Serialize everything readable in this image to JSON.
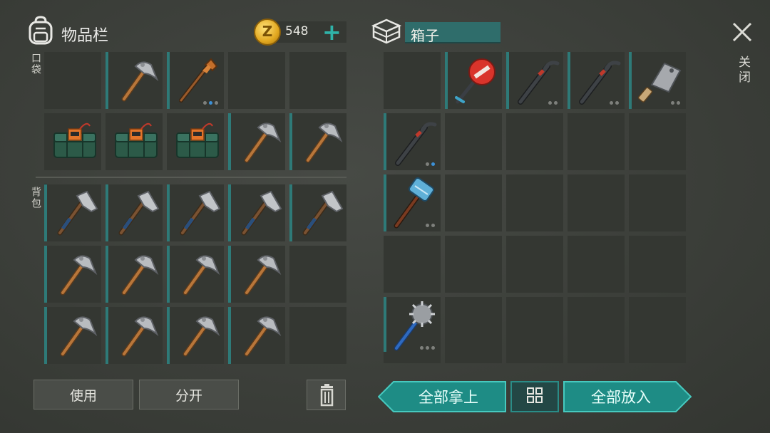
{
  "inventory": {
    "title": "物品栏",
    "pocket_label": "口袋",
    "backpack_label": "背包",
    "coins": {
      "symbol": "Z",
      "amount": "548",
      "add": "+"
    }
  },
  "container": {
    "name": "箱子"
  },
  "close": {
    "label": "关闭"
  },
  "buttons": {
    "use": "使用",
    "split": "分开",
    "take_all": "全部拿上",
    "put_all": "全部放入"
  },
  "colors": {
    "accent": "#2fb3a9",
    "slot": "#343732",
    "strip": "#2e7a78"
  },
  "pocket_slots": [
    {
      "item": "",
      "strip": false,
      "dots": []
    },
    {
      "item": "pickaxe-icon",
      "strip": true,
      "dots": []
    },
    {
      "item": "hoe-icon",
      "strip": true,
      "dots": [
        "g",
        "b",
        "g"
      ]
    },
    {
      "item": "",
      "strip": false,
      "dots": []
    },
    {
      "item": "",
      "strip": false,
      "dots": []
    },
    {
      "item": "explosive-pack-icon",
      "strip": false,
      "dots": []
    },
    {
      "item": "explosive-pack-icon",
      "strip": false,
      "dots": []
    },
    {
      "item": "explosive-pack-icon",
      "strip": false,
      "dots": []
    },
    {
      "item": "pickaxe-icon",
      "strip": true,
      "dots": []
    },
    {
      "item": "pickaxe-icon",
      "strip": true,
      "dots": []
    }
  ],
  "backpack_slots": [
    {
      "item": "hatchet-icon",
      "strip": true,
      "dots": []
    },
    {
      "item": "hatchet-icon",
      "strip": true,
      "dots": []
    },
    {
      "item": "hatchet-icon",
      "strip": true,
      "dots": []
    },
    {
      "item": "hatchet-icon",
      "strip": true,
      "dots": []
    },
    {
      "item": "hatchet-icon",
      "strip": true,
      "dots": []
    },
    {
      "item": "pickaxe-icon",
      "strip": true,
      "dots": []
    },
    {
      "item": "pickaxe-icon",
      "strip": true,
      "dots": []
    },
    {
      "item": "pickaxe-icon",
      "strip": true,
      "dots": []
    },
    {
      "item": "pickaxe-icon",
      "strip": true,
      "dots": []
    },
    {
      "item": "",
      "strip": false,
      "dots": []
    },
    {
      "item": "pickaxe-icon",
      "strip": true,
      "dots": []
    },
    {
      "item": "pickaxe-icon",
      "strip": true,
      "dots": []
    },
    {
      "item": "pickaxe-icon",
      "strip": true,
      "dots": []
    },
    {
      "item": "pickaxe-icon",
      "strip": true,
      "dots": []
    },
    {
      "item": "",
      "strip": false,
      "dots": []
    }
  ],
  "chest_slots": [
    {
      "item": "",
      "strip": false,
      "dots": []
    },
    {
      "item": "stop-sign-icon",
      "strip": true,
      "dots": []
    },
    {
      "item": "crowbar-icon",
      "strip": true,
      "dots": [
        "g",
        "g"
      ]
    },
    {
      "item": "crowbar-icon",
      "strip": true,
      "dots": [
        "g",
        "g"
      ]
    },
    {
      "item": "cleaver-icon",
      "strip": true,
      "dots": [
        "g",
        "g"
      ]
    },
    {
      "item": "crowbar-icon",
      "strip": true,
      "dots": [
        "g",
        "b"
      ]
    },
    {
      "item": "",
      "strip": false,
      "dots": []
    },
    {
      "item": "",
      "strip": false,
      "dots": []
    },
    {
      "item": "",
      "strip": false,
      "dots": []
    },
    {
      "item": "",
      "strip": false,
      "dots": []
    },
    {
      "item": "sledgehammer-icon",
      "strip": true,
      "dots": [
        "g",
        "g"
      ]
    },
    {
      "item": "",
      "strip": false,
      "dots": []
    },
    {
      "item": "",
      "strip": false,
      "dots": []
    },
    {
      "item": "",
      "strip": false,
      "dots": []
    },
    {
      "item": "",
      "strip": false,
      "dots": []
    },
    {
      "item": "",
      "strip": false,
      "dots": []
    },
    {
      "item": "",
      "strip": false,
      "dots": []
    },
    {
      "item": "",
      "strip": false,
      "dots": []
    },
    {
      "item": "",
      "strip": false,
      "dots": []
    },
    {
      "item": "",
      "strip": false,
      "dots": []
    },
    {
      "item": "spiked-mace-icon",
      "strip": true,
      "dots": [
        "g",
        "g",
        "g"
      ]
    },
    {
      "item": "",
      "strip": false,
      "dots": []
    },
    {
      "item": "",
      "strip": false,
      "dots": []
    },
    {
      "item": "",
      "strip": false,
      "dots": []
    },
    {
      "item": "",
      "strip": false,
      "dots": []
    }
  ]
}
